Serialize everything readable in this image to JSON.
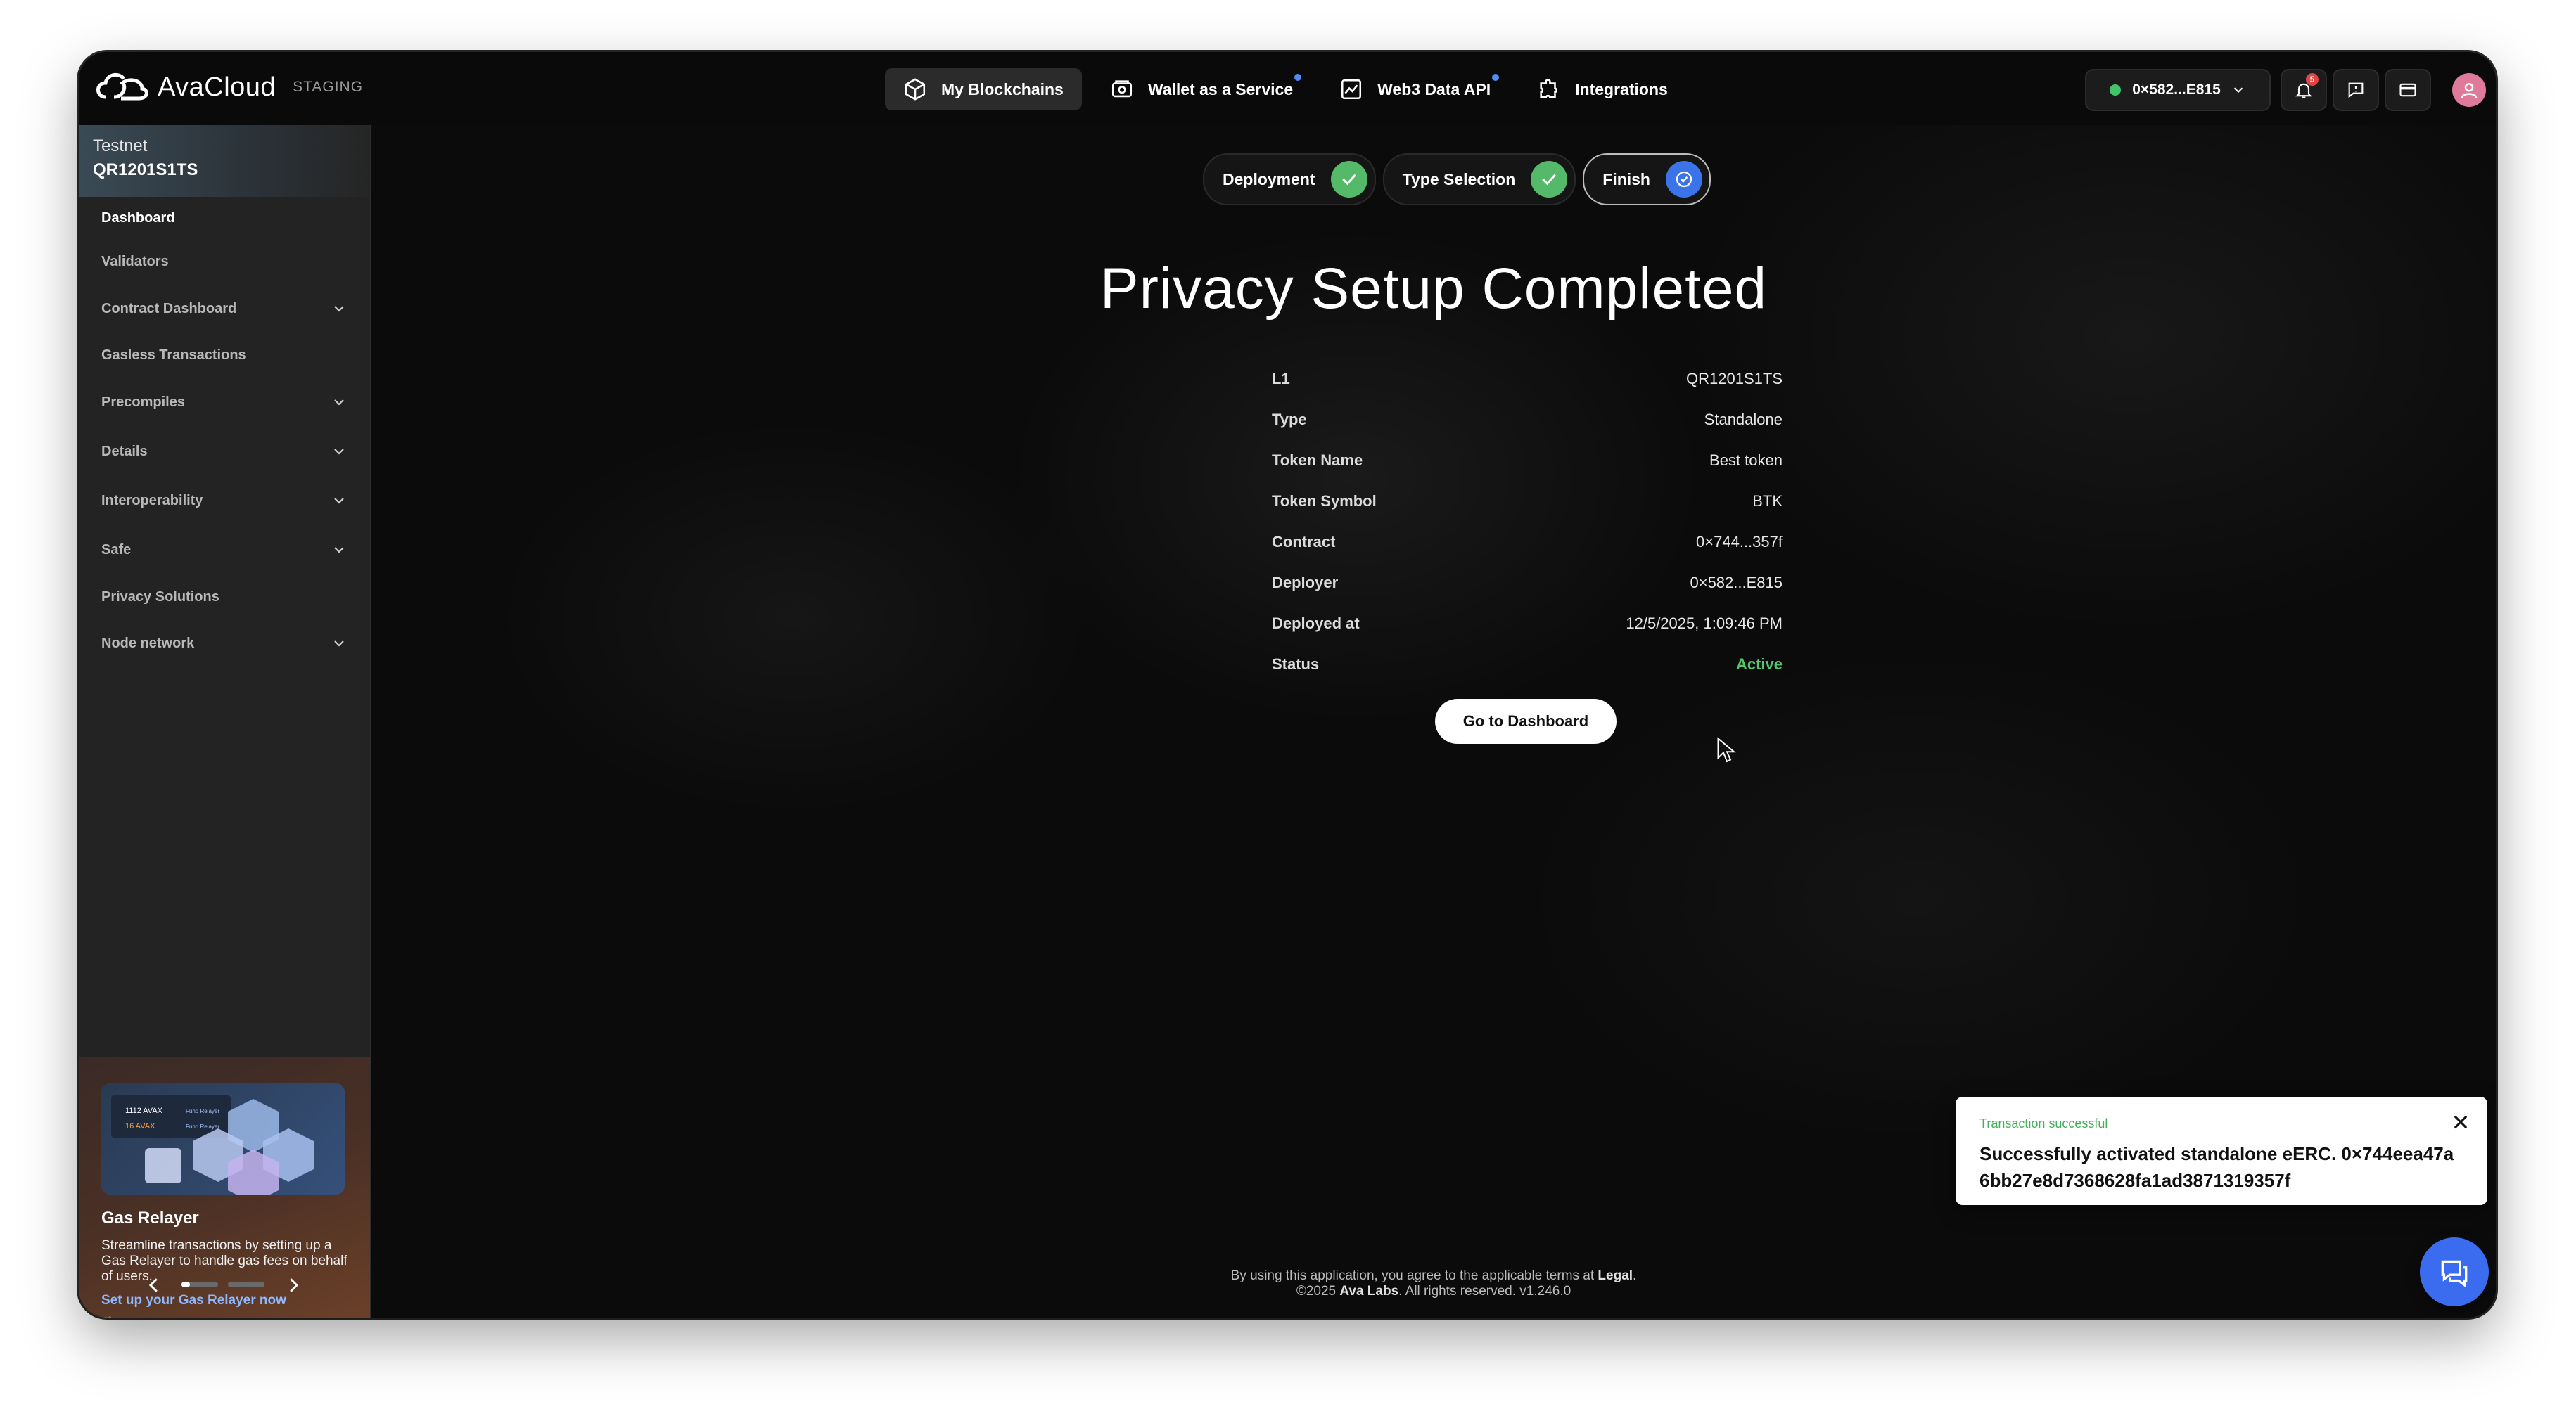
{
  "app": {
    "logo_text": "AvaCloud",
    "environment": "STAGING"
  },
  "nav": {
    "items": [
      {
        "label": "My Blockchains",
        "icon": "cube-icon",
        "active": true,
        "dot": false
      },
      {
        "label": "Wallet as a Service",
        "icon": "wallet-icon",
        "active": false,
        "dot": true
      },
      {
        "label": "Web3 Data API",
        "icon": "chart-icon",
        "active": false,
        "dot": true
      },
      {
        "label": "Integrations",
        "icon": "puzzle-icon",
        "active": false,
        "dot": false
      }
    ]
  },
  "header_right": {
    "wallet_address": "0×582...E815",
    "wallet_status_color": "#43c46a",
    "notification_count": "5",
    "icons": [
      "bell-icon",
      "feedback-icon",
      "wallet-card-icon",
      "user-avatar-icon"
    ]
  },
  "sidebar": {
    "network": "Testnet",
    "chain_name": "QR1201S1TS",
    "items": [
      {
        "label": "Dashboard",
        "expandable": false,
        "active": true
      },
      {
        "label": "Validators",
        "expandable": false,
        "active": false
      },
      {
        "label": "Contract Dashboard",
        "expandable": true,
        "active": false
      },
      {
        "label": "Gasless Transactions",
        "expandable": false,
        "active": false
      },
      {
        "label": "Precompiles",
        "expandable": true,
        "active": false
      },
      {
        "label": "Details",
        "expandable": true,
        "active": false
      },
      {
        "label": "Interoperability",
        "expandable": true,
        "active": false
      },
      {
        "label": "Safe",
        "expandable": true,
        "active": false
      },
      {
        "label": "Privacy Solutions",
        "expandable": false,
        "active": false
      },
      {
        "label": "Node network",
        "expandable": true,
        "active": false
      }
    ],
    "promo": {
      "title": "Gas Relayer",
      "description": "Streamline transactions by setting up a Gas Relayer to handle gas fees on behalf of users.",
      "link": "Set up your Gas Relayer now",
      "link_arrow": "→",
      "image_texts": [
        "1112 AVAX",
        "16 AVAX",
        "Fund Relayer",
        "Fund Relayer"
      ]
    },
    "carousel": {
      "current_slide": 1,
      "total_slides": 2
    }
  },
  "steps": [
    {
      "label": "Deployment",
      "state": "done"
    },
    {
      "label": "Type Selection",
      "state": "done"
    },
    {
      "label": "Finish",
      "state": "current"
    }
  ],
  "main": {
    "title": "Privacy Setup Completed",
    "details": [
      {
        "label": "L1",
        "value": "QR1201S1TS"
      },
      {
        "label": "Type",
        "value": "Standalone"
      },
      {
        "label": "Token Name",
        "value": "Best token"
      },
      {
        "label": "Token Symbol",
        "value": "BTK"
      },
      {
        "label": "Contract",
        "value": "0×744...357f"
      },
      {
        "label": "Deployer",
        "value": "0×582...E815"
      },
      {
        "label": "Deployed at",
        "value": "12/5/2025, 1:09:46 PM"
      },
      {
        "label": "Status",
        "value": "Active"
      }
    ],
    "status_color": "#55c46e",
    "button_label": "Go to Dashboard"
  },
  "footer": {
    "line1_prefix": "By using this application, you agree to the applicable terms at ",
    "line1_link": "Legal",
    "line1_suffix": ".",
    "line2_prefix": "©2025 ",
    "line2_company": "Ava Labs",
    "line2_suffix": ".  All rights reserved.  v1.246.0"
  },
  "toast": {
    "kicker": "Transaction successful",
    "message": "Successfully activated standalone eERC. 0×744eea47a6bb27e8d7368628fa1ad3871319357f",
    "kicker_color": "#43b05c"
  },
  "chat": {
    "icon": "chat-icon"
  }
}
